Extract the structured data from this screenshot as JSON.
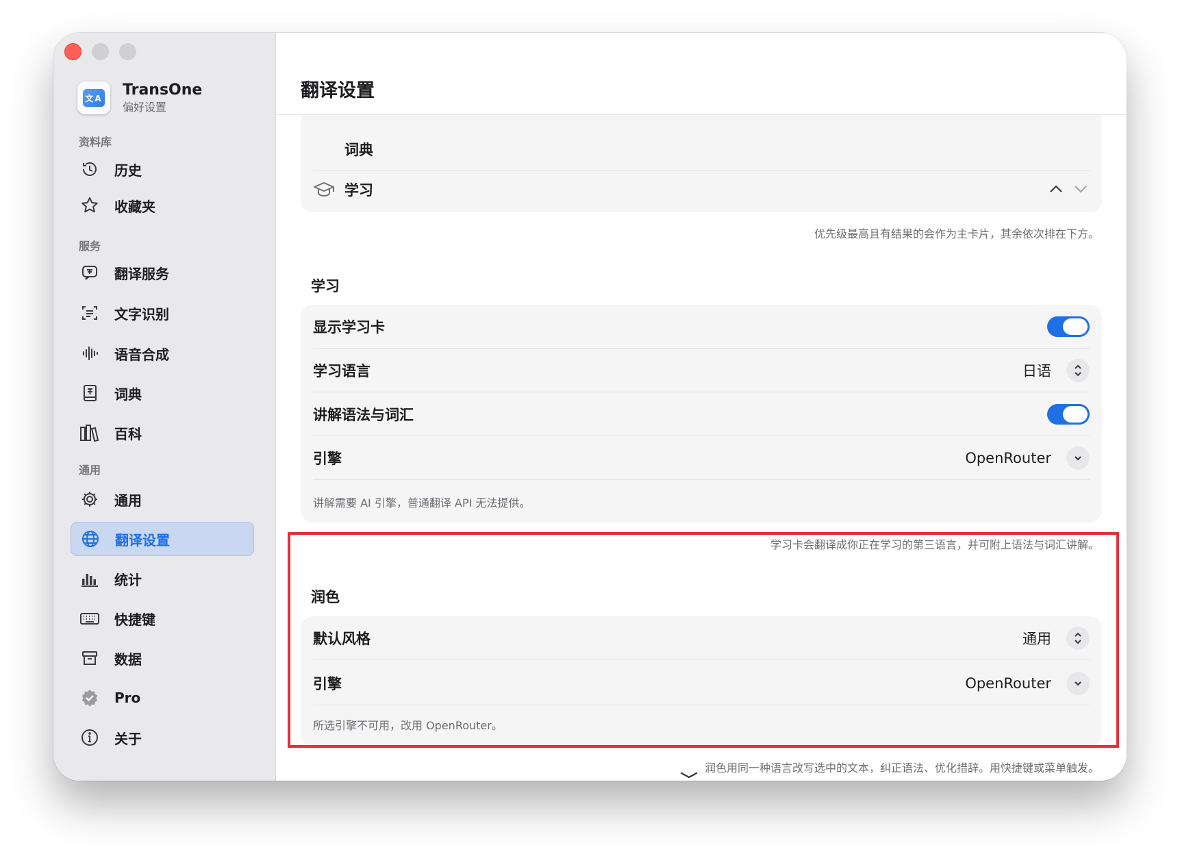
{
  "app": {
    "name": "TransOne",
    "subtitle": "偏好设置",
    "icon_text": "文A"
  },
  "sidebar": {
    "sections": [
      {
        "label": "资料库"
      },
      {
        "label": "服务"
      },
      {
        "label": "通用"
      }
    ],
    "items": [
      {
        "label": "历史",
        "icon": "history-clock-icon"
      },
      {
        "label": "收藏夹",
        "icon": "star-icon"
      },
      {
        "label": "翻译服务",
        "icon": "translate-bubble-icon"
      },
      {
        "label": "文字识别",
        "icon": "text-scan-icon"
      },
      {
        "label": "语音合成",
        "icon": "waveform-icon"
      },
      {
        "label": "词典",
        "icon": "dictionary-book-icon"
      },
      {
        "label": "百科",
        "icon": "books-icon"
      },
      {
        "label": "通用",
        "icon": "gear-icon"
      },
      {
        "label": "翻译设置",
        "icon": "globe-icon",
        "active": true
      },
      {
        "label": "统计",
        "icon": "bar-chart-icon"
      },
      {
        "label": "快捷键",
        "icon": "keyboard-icon"
      },
      {
        "label": "数据",
        "icon": "archive-box-icon"
      },
      {
        "label": "Pro",
        "icon": "seal-check-icon"
      },
      {
        "label": "关于",
        "icon": "info-icon"
      }
    ]
  },
  "main": {
    "title": "翻译设置",
    "partial_card": {
      "hidden_row": "词典",
      "row_label": "学习"
    },
    "priority_note": "优先级最高且有结果的会作为主卡片，其余依次排在下方。",
    "learning": {
      "title": "学习",
      "show_card_label": "显示学习卡",
      "show_card_on": true,
      "language_label": "学习语言",
      "language_value": "日语",
      "explain_label": "讲解语法与词汇",
      "explain_on": true,
      "engine_label": "引擎",
      "engine_value": "OpenRouter",
      "inner_note": "讲解需要 AI 引擎，普通翻译 API 无法提供。",
      "footnote": "学习卡会翻译成你正在学习的第三语言，并可附上语法与词汇讲解。"
    },
    "polish": {
      "title": "润色",
      "style_label": "默认风格",
      "style_value": "通用",
      "engine_label": "引擎",
      "engine_value": "OpenRouter",
      "inner_note": "所选引擎不可用，改用 OpenRouter。",
      "footnote": "润色用同一种语言改写选中的文本，纠正语法、优化措辞。用快捷键或菜单触发。"
    }
  },
  "colors": {
    "accent": "#1f6fe5",
    "highlight": "#e5303a",
    "sidebar_bg": "#e9e8ea"
  }
}
